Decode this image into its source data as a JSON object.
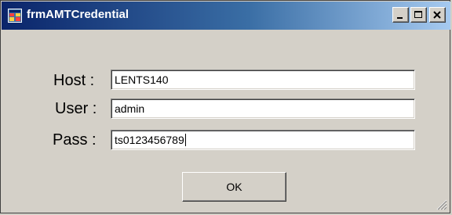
{
  "window": {
    "title": "frmAMTCredential",
    "icon": "form-app-icon",
    "buttons": [
      "minimize-icon",
      "maximize-icon",
      "close-icon"
    ]
  },
  "form": {
    "host": {
      "label": "Host :",
      "value": "LENTS140"
    },
    "user": {
      "label": "User :",
      "value": "admin"
    },
    "pass": {
      "label": "Pass :",
      "value": "ts0123456789"
    }
  },
  "ok_button": {
    "label": "OK"
  },
  "colors": {
    "titlebar_start": "#0a246a",
    "titlebar_end": "#a6caf0",
    "face": "#d4d0c8"
  }
}
